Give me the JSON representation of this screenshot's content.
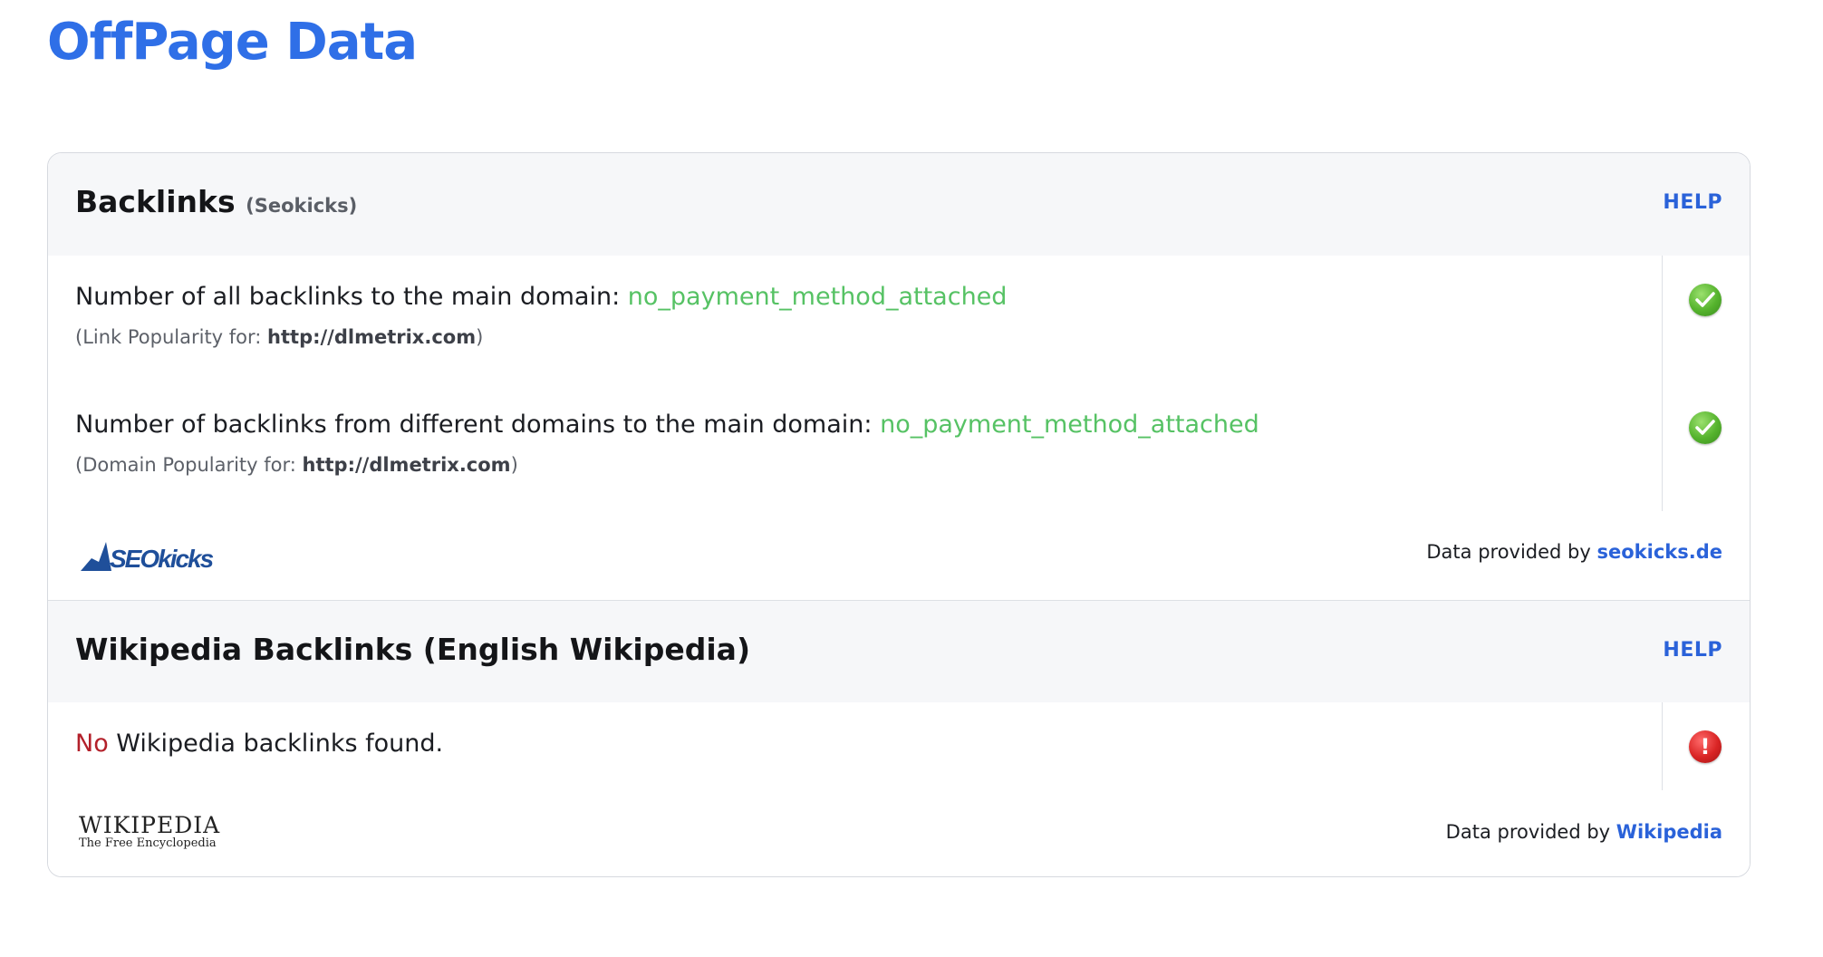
{
  "page": {
    "title": "OffPage Data"
  },
  "backlinks": {
    "title": "Backlinks",
    "subtitle": "(Seokicks)",
    "help_label": "HELP",
    "rows": [
      {
        "label": "Number of all backlinks to the main domain:",
        "value": "no_payment_method_attached",
        "note_prefix": "(Link Popularity for: ",
        "note_url": "http://dlmetrix.com",
        "note_suffix": ")",
        "status": "ok"
      },
      {
        "label": "Number of backlinks from different domains to the main domain:",
        "value": "no_payment_method_attached",
        "note_prefix": "(Domain Popularity for: ",
        "note_url": "http://dlmetrix.com",
        "note_suffix": ")",
        "status": "ok"
      }
    ],
    "footer": {
      "logo_text": "SEOkicks",
      "provided_prefix": "Data provided by ",
      "provided_link": "seokicks.de"
    }
  },
  "wikipedia": {
    "title": "Wikipedia Backlinks (English Wikipedia)",
    "help_label": "HELP",
    "row": {
      "no_word": "No",
      "text": " Wikipedia backlinks found.",
      "status": "error",
      "status_glyph": "!"
    },
    "footer": {
      "logo_title": "WIKIPEDIA",
      "logo_tagline": "The Free Encyclopedia",
      "provided_prefix": "Data provided by ",
      "provided_link": "Wikipedia"
    }
  },
  "colors": {
    "title_blue": "#2f6fe7",
    "link_blue": "#2a62d9",
    "value_green": "#56c264",
    "no_red": "#b3202a"
  }
}
